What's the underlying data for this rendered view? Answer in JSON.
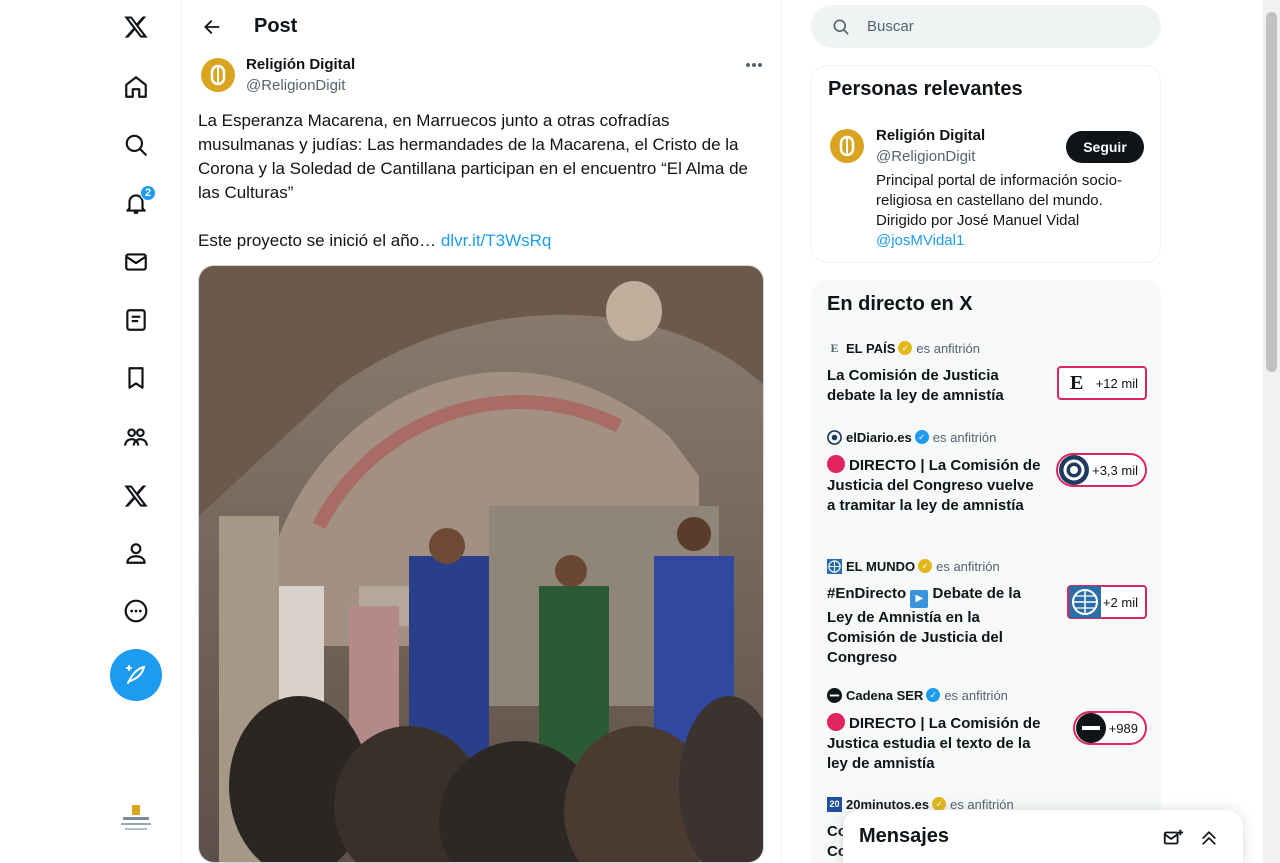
{
  "nav": {
    "items": [
      {
        "name": "x-logo-icon"
      },
      {
        "name": "home-icon"
      },
      {
        "name": "explore-icon"
      },
      {
        "name": "notifications-icon",
        "badge": "2"
      },
      {
        "name": "messages-icon"
      },
      {
        "name": "lists-icon"
      },
      {
        "name": "bookmarks-icon"
      },
      {
        "name": "communities-icon"
      },
      {
        "name": "premium-x-icon"
      },
      {
        "name": "profile-icon"
      },
      {
        "name": "more-icon"
      }
    ],
    "compose_icon": "compose-feather-icon"
  },
  "header": {
    "title": "Post"
  },
  "post": {
    "author_name": "Religión Digital",
    "author_handle": "@ReligionDigit",
    "paragraph1": "La Esperanza Macarena, en Marruecos junto a otras cofradías musulmanas y judías: Las hermandades de la Macarena, el Cristo de la Corona y la Soledad de Cantillana participan en el encuentro “El Alma de las Culturas”",
    "paragraph2_prefix": "Este proyecto se inició el año… ",
    "link": "dlvr.it/T3WsRq"
  },
  "search": {
    "placeholder": "Buscar"
  },
  "relevant": {
    "title": "Personas relevantes",
    "name": "Religión Digital",
    "handle": "@ReligionDigit",
    "follow_label": "Seguir",
    "bio": "Principal portal de información socio-religiosa en castellano del mundo. Dirigido por José Manuel Vidal ",
    "bio_link": "@josMVidal1"
  },
  "live": {
    "title": "En directo en X",
    "items": [
      {
        "host": "EL PAÍS",
        "role": "es anfitrión",
        "title": "La Comisión de Justicia debate la ley de amnistía",
        "listeners": "+12 mil",
        "verified_color": "#e2b719"
      },
      {
        "host": "elDiario.es",
        "role": "es anfitrión",
        "title": "DIRECTO | La Comisión de Justicia del Congreso vuelve a tramitar la ley de amnistía",
        "listeners": "+3,3 mil",
        "verified_color": "#1d9bf0"
      },
      {
        "host": "EL MUNDO",
        "role": "es anfitrión",
        "title_a": "#EnDirecto",
        "title_b": " Debate de la Ley de Amnistía en la Comisión de Justicia del Congreso",
        "listeners": "+2 mil",
        "verified_color": "#e2b719"
      },
      {
        "host": "Cadena SER",
        "role": "es anfitrión",
        "title": "DIRECTO | La Comisión de Justica estudia el texto de la ley de amnistía",
        "listeners": "+989",
        "verified_color": "#1d9bf0"
      },
      {
        "host": "20minutos.es",
        "role": "es anfitrión",
        "title": "Co Co",
        "verified_color": "#e2b719"
      }
    ]
  },
  "messages": {
    "title": "Mensajes"
  }
}
